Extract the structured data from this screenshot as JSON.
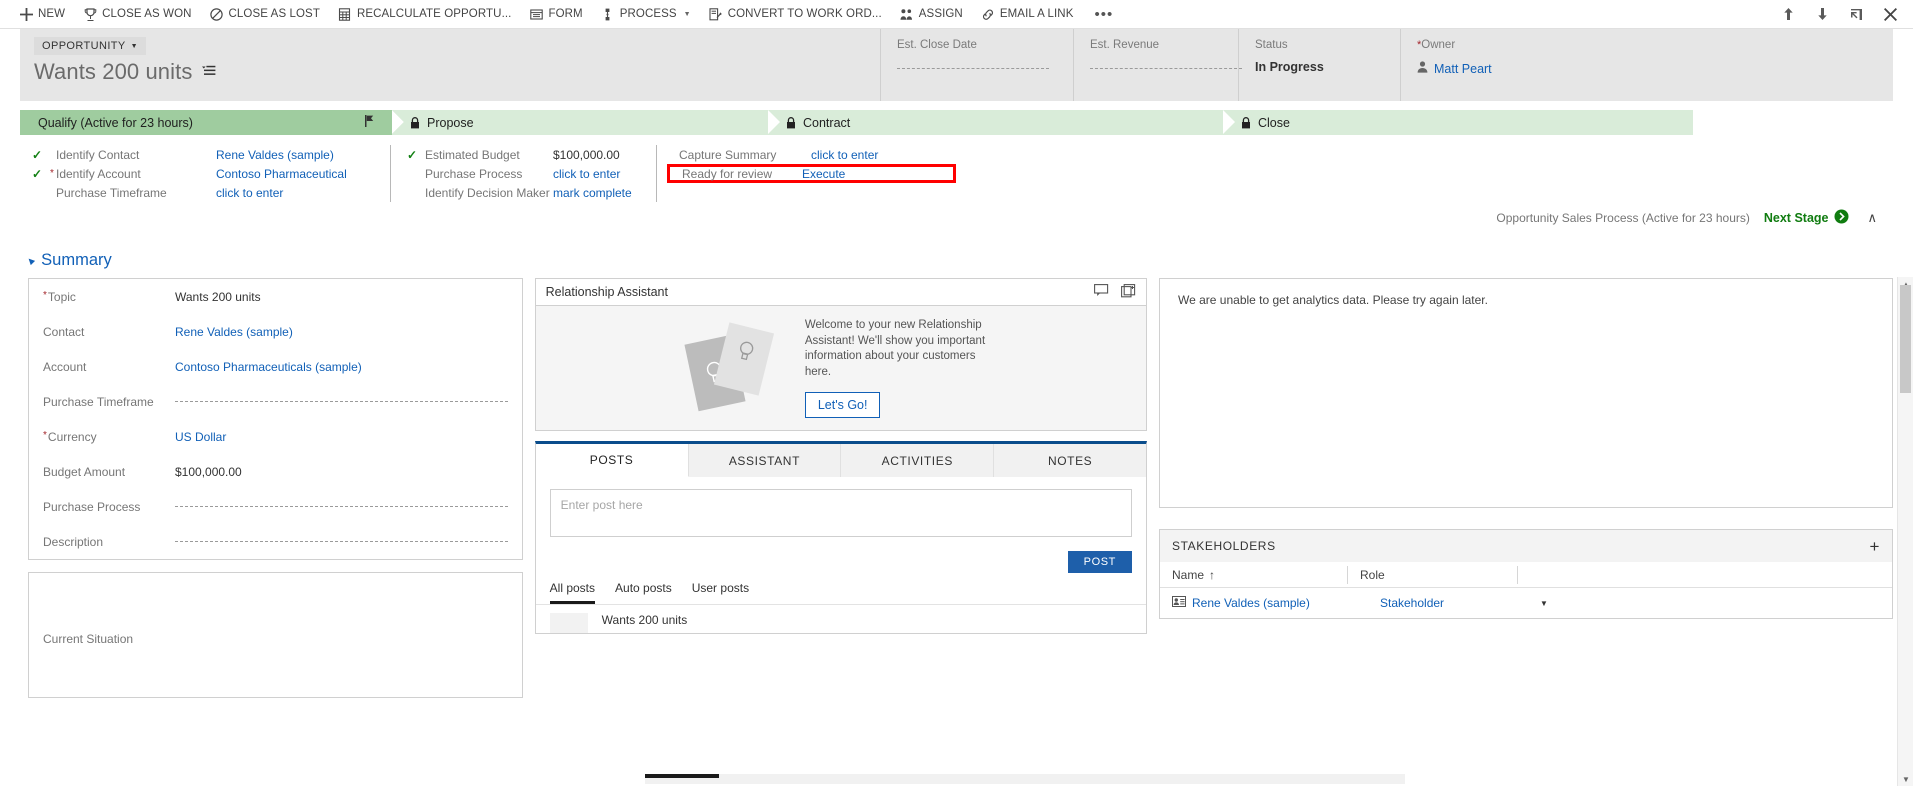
{
  "commandbar": {
    "items": [
      {
        "label": "NEW",
        "icon": "plus-icon"
      },
      {
        "label": "CLOSE AS WON",
        "icon": "trophy-icon"
      },
      {
        "label": "CLOSE AS LOST",
        "icon": "prohibition-icon"
      },
      {
        "label": "RECALCULATE OPPORTU...",
        "icon": "calculator-icon"
      },
      {
        "label": "FORM",
        "icon": "form-icon"
      },
      {
        "label": "PROCESS",
        "icon": "process-icon",
        "caret": true
      },
      {
        "label": "CONVERT TO WORK ORD...",
        "icon": "convert-workorder-icon"
      },
      {
        "label": "ASSIGN",
        "icon": "assign-users-icon"
      },
      {
        "label": "EMAIL A LINK",
        "icon": "link-icon"
      }
    ],
    "overflow": "•••",
    "right_buttons": [
      {
        "name": "previous-record-button",
        "glyph": "↑"
      },
      {
        "name": "next-record-button",
        "glyph": "↓"
      },
      {
        "name": "popout-button",
        "glyph": "❐"
      },
      {
        "name": "close-button",
        "glyph": "✕"
      }
    ]
  },
  "header": {
    "entity_label": "OPPORTUNITY",
    "record_title": "Wants 200 units",
    "fields": [
      {
        "label": "Est. Close Date",
        "value": "",
        "required": false,
        "empty": true
      },
      {
        "label": "Est. Revenue",
        "value": "",
        "required": false,
        "empty": true
      },
      {
        "label": "Status",
        "value": "In Progress",
        "required": false,
        "empty": false
      },
      {
        "label": "Owner",
        "value": "Matt Peart",
        "required": true,
        "empty": false,
        "is_link": true
      }
    ]
  },
  "process": {
    "stages": [
      {
        "label": "Qualify (Active for 23 hours)",
        "active": true,
        "locked": false
      },
      {
        "label": "Propose",
        "active": false,
        "locked": true
      },
      {
        "label": "Contract",
        "active": false,
        "locked": true
      },
      {
        "label": "Close",
        "active": false,
        "locked": true
      }
    ],
    "step_groups": [
      {
        "steps": [
          {
            "name": "Identify Contact",
            "value": "Rene Valdes (sample)",
            "complete": true,
            "required": false,
            "link": true
          },
          {
            "name": "Identify Account",
            "value": "Contoso Pharmaceutical",
            "complete": true,
            "required": true,
            "link": true
          },
          {
            "name": "Purchase Timeframe",
            "value": "click to enter",
            "complete": false,
            "required": false,
            "link": true
          }
        ]
      },
      {
        "steps": [
          {
            "name": "Estimated Budget",
            "value": "$100,000.00",
            "complete": true,
            "required": false,
            "link": false
          },
          {
            "name": "Purchase Process",
            "value": "click to enter",
            "complete": false,
            "required": false,
            "link": true
          },
          {
            "name": "Identify Decision Maker",
            "value": "mark complete",
            "complete": false,
            "required": false,
            "link": true
          }
        ]
      },
      {
        "steps": [
          {
            "name": "Capture Summary",
            "value": "click to enter",
            "complete": false,
            "required": false,
            "link": true
          },
          {
            "name": "Ready for review",
            "value": "Execute",
            "complete": false,
            "required": false,
            "link": true,
            "highlighted": true
          }
        ]
      }
    ],
    "process_name": "Opportunity Sales Process (Active for 23 hours)",
    "next_stage_label": "Next Stage",
    "collapse_glyph": "∧"
  },
  "summary": {
    "title": "Summary",
    "fields": [
      {
        "label": "Topic",
        "value": "Wants 200 units",
        "required": true,
        "link": false,
        "empty": false
      },
      {
        "label": "Contact",
        "value": "Rene Valdes (sample)",
        "required": false,
        "link": true,
        "empty": false
      },
      {
        "label": "Account",
        "value": "Contoso Pharmaceuticals (sample)",
        "required": false,
        "link": true,
        "empty": false
      },
      {
        "label": "Purchase Timeframe",
        "value": "",
        "required": false,
        "link": false,
        "empty": true
      },
      {
        "label": "Currency",
        "value": "US Dollar",
        "required": true,
        "link": true,
        "empty": false
      },
      {
        "label": "Budget Amount",
        "value": "$100,000.00",
        "required": false,
        "link": false,
        "empty": false
      },
      {
        "label": "Purchase Process",
        "value": "",
        "required": false,
        "link": false,
        "empty": true
      },
      {
        "label": "Description",
        "value": "",
        "required": false,
        "link": false,
        "empty": true
      }
    ],
    "second_card": [
      {
        "label": "Current Situation",
        "value": "",
        "required": false,
        "link": false,
        "empty": true
      }
    ]
  },
  "relationship_assistant": {
    "title": "Relationship Assistant",
    "welcome_text": "Welcome to your new Relationship Assistant! We'll show you important information about your customers here.",
    "cta_label": "Let's Go!",
    "header_icons": [
      "feedback-icon",
      "cards-icon"
    ]
  },
  "social_pane": {
    "tabs": [
      {
        "label": "POSTS",
        "selected": true
      },
      {
        "label": "ASSISTANT",
        "selected": false
      },
      {
        "label": "ACTIVITIES",
        "selected": false
      },
      {
        "label": "NOTES",
        "selected": false
      }
    ],
    "post_placeholder": "Enter post here",
    "post_button": "POST",
    "filters": [
      {
        "label": "All posts",
        "selected": true
      },
      {
        "label": "Auto posts",
        "selected": false
      },
      {
        "label": "User posts",
        "selected": false
      }
    ],
    "feed": [
      {
        "text": "Wants 200 units"
      }
    ]
  },
  "analytics": {
    "message": "We are unable to get analytics data. Please try again later."
  },
  "stakeholders": {
    "title": "STAKEHOLDERS",
    "add_glyph": "+",
    "columns": [
      {
        "label": "Name",
        "sort": "↑"
      },
      {
        "label": "Role",
        "sort": ""
      }
    ],
    "rows": [
      {
        "name": "Rene Valdes (sample)",
        "role": "Stakeholder"
      }
    ]
  },
  "colors": {
    "accent_blue": "#1160b7",
    "stage_active": "#9fcc9f",
    "stage_inactive": "#d9ecd9",
    "highlight_red": "#ff0000",
    "post_button": "#1e5faa",
    "next_stage_green": "#107c10"
  }
}
